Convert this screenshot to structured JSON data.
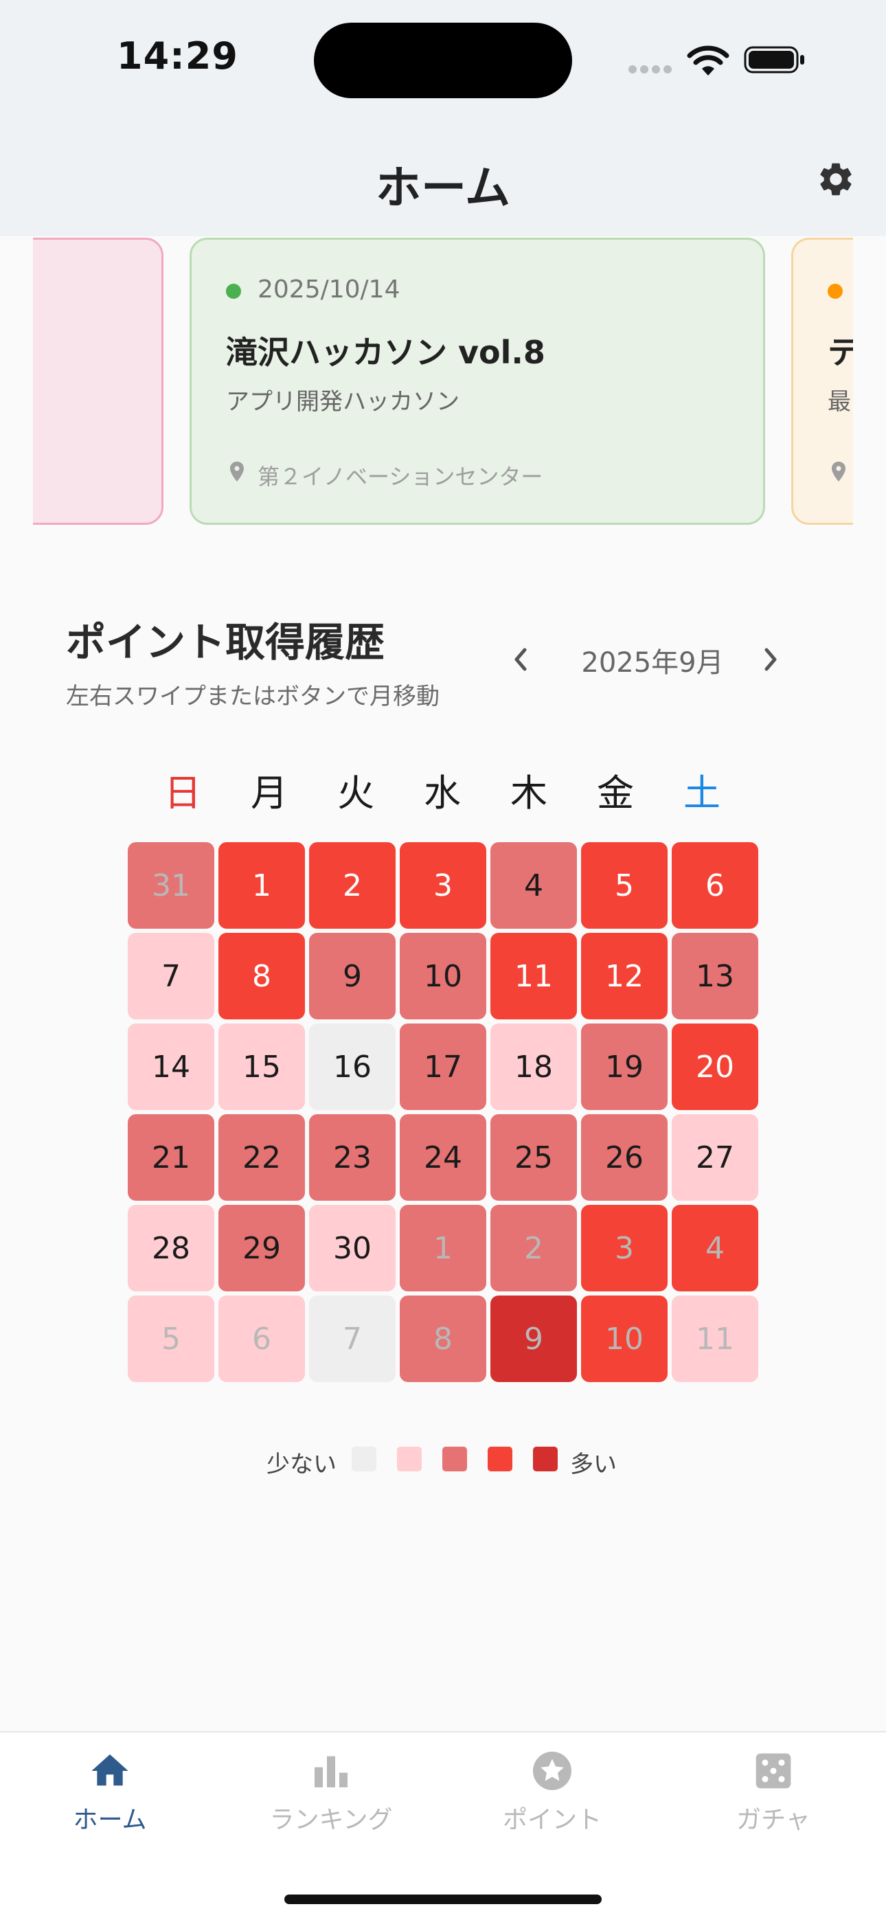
{
  "status_bar": {
    "time": "14:29"
  },
  "header": {
    "title": "ホーム",
    "settings_icon": "gear-icon"
  },
  "events": {
    "main": {
      "date": "2025/10/14",
      "title": "滝沢ハッカソン vol.8",
      "subtitle": "アプリ開発ハッカソン",
      "location": "第２イノベーションセンター",
      "dot_color": "#4caf50"
    },
    "next": {
      "title_fragment": "テ",
      "subtitle_fragment": "最",
      "dot_color": "#ff9800"
    }
  },
  "points": {
    "title": "ポイント取得履歴",
    "subtitle": "左右スワイプまたはボタンで月移動",
    "month": "2025年9月",
    "weekdays": [
      "日",
      "月",
      "火",
      "水",
      "木",
      "金",
      "土"
    ],
    "level_colors": [
      "#eeeeee",
      "#ffcdd2",
      "#e57373",
      "#f44336",
      "#d32f2f"
    ],
    "weeks": [
      [
        {
          "d": "31",
          "lv": 2,
          "out": true
        },
        {
          "d": "1",
          "lv": 3
        },
        {
          "d": "2",
          "lv": 3
        },
        {
          "d": "3",
          "lv": 3
        },
        {
          "d": "4",
          "lv": 2
        },
        {
          "d": "5",
          "lv": 3
        },
        {
          "d": "6",
          "lv": 3
        }
      ],
      [
        {
          "d": "7",
          "lv": 1
        },
        {
          "d": "8",
          "lv": 3
        },
        {
          "d": "9",
          "lv": 2
        },
        {
          "d": "10",
          "lv": 2
        },
        {
          "d": "11",
          "lv": 3
        },
        {
          "d": "12",
          "lv": 3
        },
        {
          "d": "13",
          "lv": 2
        }
      ],
      [
        {
          "d": "14",
          "lv": 1
        },
        {
          "d": "15",
          "lv": 1
        },
        {
          "d": "16",
          "lv": 0
        },
        {
          "d": "17",
          "lv": 2
        },
        {
          "d": "18",
          "lv": 1
        },
        {
          "d": "19",
          "lv": 2
        },
        {
          "d": "20",
          "lv": 3
        }
      ],
      [
        {
          "d": "21",
          "lv": 2
        },
        {
          "d": "22",
          "lv": 2
        },
        {
          "d": "23",
          "lv": 2
        },
        {
          "d": "24",
          "lv": 2
        },
        {
          "d": "25",
          "lv": 2
        },
        {
          "d": "26",
          "lv": 2
        },
        {
          "d": "27",
          "lv": 1
        }
      ],
      [
        {
          "d": "28",
          "lv": 1
        },
        {
          "d": "29",
          "lv": 2
        },
        {
          "d": "30",
          "lv": 1
        },
        {
          "d": "1",
          "lv": 2,
          "out": true
        },
        {
          "d": "2",
          "lv": 2,
          "out": true
        },
        {
          "d": "3",
          "lv": 3,
          "out": true
        },
        {
          "d": "4",
          "lv": 3,
          "out": true
        }
      ],
      [
        {
          "d": "5",
          "lv": 1,
          "out": true
        },
        {
          "d": "6",
          "lv": 1,
          "out": true
        },
        {
          "d": "7",
          "lv": 0,
          "out": true
        },
        {
          "d": "8",
          "lv": 2,
          "out": true
        },
        {
          "d": "9",
          "lv": 4,
          "out": true
        },
        {
          "d": "10",
          "lv": 3,
          "out": true
        },
        {
          "d": "11",
          "lv": 1,
          "out": true
        }
      ]
    ],
    "legend": {
      "low": "少ない",
      "high": "多い"
    }
  },
  "bottom_nav": {
    "tabs": [
      {
        "label": "ホーム",
        "icon": "home-icon",
        "active": true
      },
      {
        "label": "ランキング",
        "icon": "bar-chart-icon",
        "active": false
      },
      {
        "label": "ポイント",
        "icon": "star-icon",
        "active": false
      },
      {
        "label": "ガチャ",
        "icon": "dice-icon",
        "active": false
      }
    ]
  }
}
